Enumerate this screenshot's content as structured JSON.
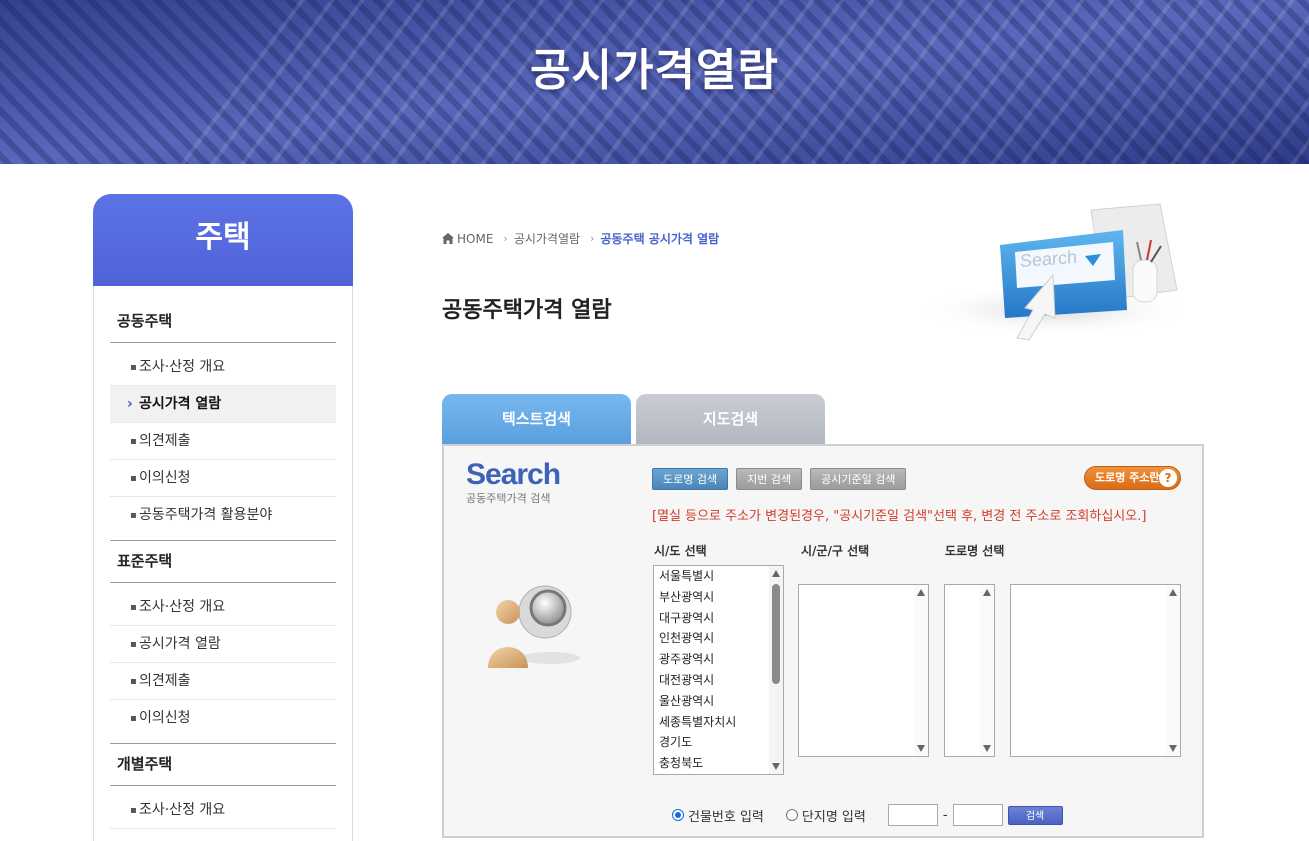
{
  "banner": {
    "title": "공시가격열람"
  },
  "sidebar": {
    "title": "주택",
    "sections": [
      {
        "title": "공동주택",
        "items": [
          {
            "label": "조사·산정 개요",
            "active": false
          },
          {
            "label": "공시가격 열람",
            "active": true
          },
          {
            "label": "의견제출",
            "active": false
          },
          {
            "label": "이의신청",
            "active": false
          },
          {
            "label": "공동주택가격 활용분야",
            "active": false
          }
        ]
      },
      {
        "title": "표준주택",
        "items": [
          {
            "label": "조사·산정 개요",
            "active": false
          },
          {
            "label": "공시가격 열람",
            "active": false
          },
          {
            "label": "의견제출",
            "active": false
          },
          {
            "label": "이의신청",
            "active": false
          }
        ]
      },
      {
        "title": "개별주택",
        "items": [
          {
            "label": "조사·산정 개요",
            "active": false
          }
        ]
      }
    ]
  },
  "breadcrumb": {
    "home": "HOME",
    "level1": "공시가격열람",
    "current": "공동주택 공시가격 열람"
  },
  "page_title": "공동주택가격 열람",
  "illustration": {
    "search_text": "Search"
  },
  "tabs": {
    "text_search": "텍스트검색",
    "map_search": "지도검색"
  },
  "panel": {
    "logo_word": "Search",
    "logo_sub": "공동주택가격 검색",
    "buttons": {
      "road": "도로명 검색",
      "lot": "지번 검색",
      "base_date": "공시기준일 검색"
    },
    "help_label": "도로명 주소란",
    "notice": "[멸실 등으로 주소가 변경된경우, \"공시기준일 검색\"선택 후, 변경 전 주소로 조회하십시오.]",
    "labels": {
      "sido": "시/도 선택",
      "sigungu": "시/군/구 선택",
      "road": "도로명 선택"
    },
    "sido_options": [
      "서울특별시",
      "부산광역시",
      "대구광역시",
      "인천광역시",
      "광주광역시",
      "대전광역시",
      "울산광역시",
      "세종특별자치시",
      "경기도",
      "충청북도"
    ],
    "radio": {
      "building_no": "건물번호 입력",
      "complex": "단지명 입력"
    },
    "dash": "-",
    "search_button": "검색"
  },
  "colors": {
    "accent": "#4f63d8",
    "tab_active": "#5a9fdf",
    "notice": "#d23c2c",
    "help": "#e07a22"
  }
}
